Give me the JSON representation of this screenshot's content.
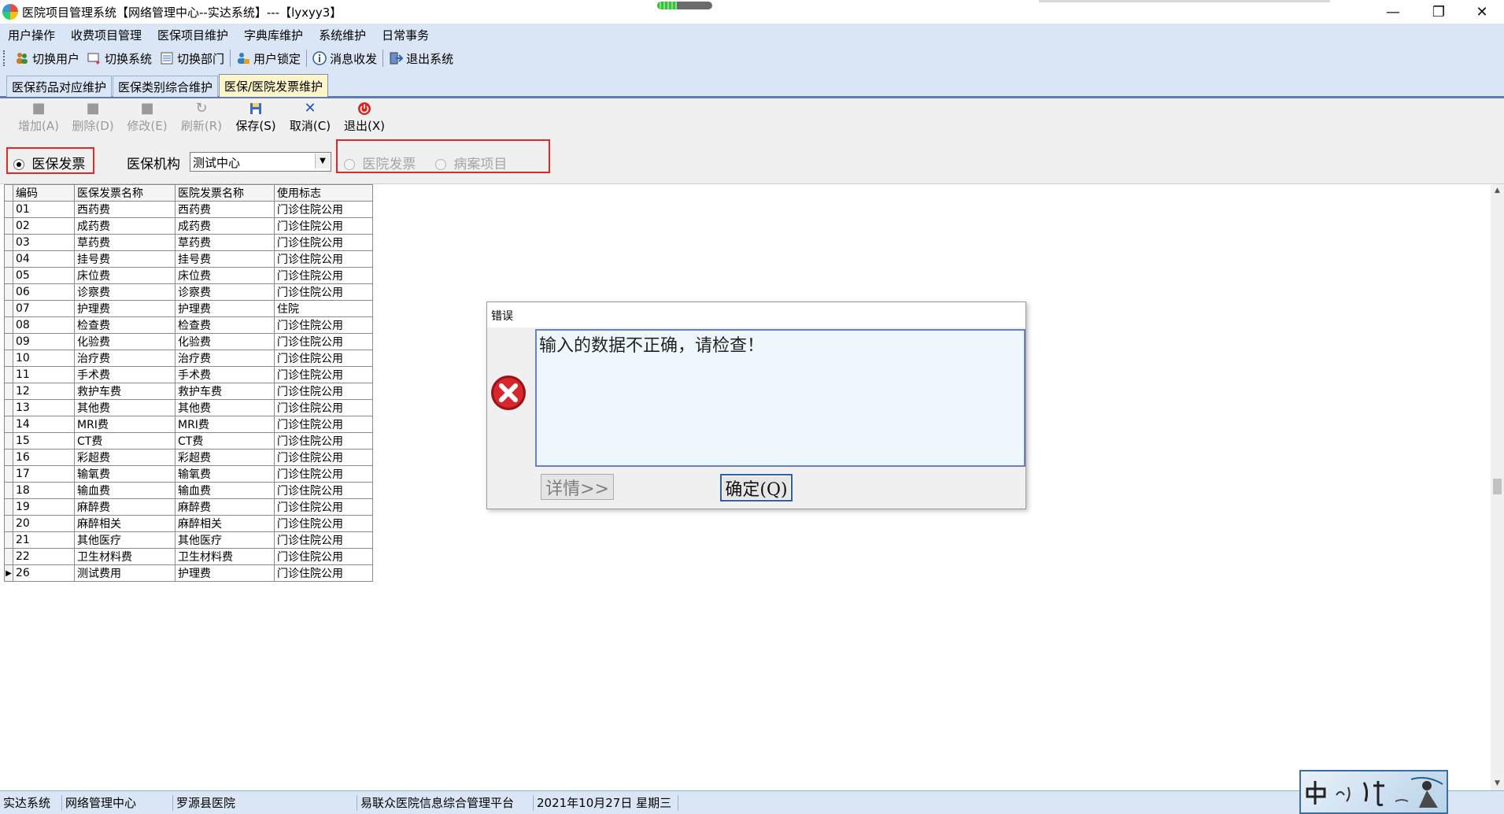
{
  "window": {
    "title": "医院项目管理系统【网络管理中心--实达系统】---【lyxyy3】",
    "controls": {
      "minimize": "—",
      "restore": "❐",
      "close": "✕"
    },
    "progress_fraction": 0.35
  },
  "menu": [
    "用户操作",
    "收费项目管理",
    "医保项目维护",
    "字典库维护",
    "系统维护",
    "日常事务"
  ],
  "quick_toolbar": [
    {
      "label": "切换用户",
      "icon": "users-icon"
    },
    {
      "label": "切换系统",
      "icon": "switch-system-icon"
    },
    {
      "label": "切换部门",
      "icon": "department-icon"
    },
    {
      "label": "用户锁定",
      "icon": "user-lock-icon"
    },
    {
      "label": "消息收发",
      "icon": "info-icon"
    },
    {
      "label": "退出系统",
      "icon": "exit-icon"
    }
  ],
  "tabs": [
    "医保药品对应维护",
    "医保类别综合维护",
    "医保/医院发票维护"
  ],
  "active_tab": "医保/医院发票维护",
  "action_toolbar": [
    {
      "label": "增加(A)",
      "enabled": false,
      "icon": "add-icon"
    },
    {
      "label": "删除(D)",
      "enabled": false,
      "icon": "delete-icon"
    },
    {
      "label": "修改(E)",
      "enabled": false,
      "icon": "edit-icon"
    },
    {
      "label": "刷新(R)",
      "enabled": false,
      "icon": "refresh-icon"
    },
    {
      "label": "保存(S)",
      "enabled": true,
      "icon": "save-icon"
    },
    {
      "label": "取消(C)",
      "enabled": true,
      "icon": "cancel-icon"
    },
    {
      "label": "退出(X)",
      "enabled": true,
      "icon": "power-icon"
    }
  ],
  "filter": {
    "insurance_invoice_label": "医保发票",
    "insurance_invoice_checked": true,
    "org_label": "医保机构",
    "org_value": "测试中心",
    "hospital_invoice_label": "医院发票",
    "case_item_label": "病案项目"
  },
  "grid": {
    "columns": [
      "编码",
      "医保发票名称",
      "医院发票名称",
      "使用标志"
    ],
    "rows": [
      [
        "01",
        "西药费",
        "西药费",
        "门诊住院公用"
      ],
      [
        "02",
        "成药费",
        "成药费",
        "门诊住院公用"
      ],
      [
        "03",
        "草药费",
        "草药费",
        "门诊住院公用"
      ],
      [
        "04",
        "挂号费",
        "挂号费",
        "门诊住院公用"
      ],
      [
        "05",
        "床位费",
        "床位费",
        "门诊住院公用"
      ],
      [
        "06",
        "诊察费",
        "诊察费",
        "门诊住院公用"
      ],
      [
        "07",
        "护理费",
        "护理费",
        "住院"
      ],
      [
        "08",
        "检查费",
        "检查费",
        "门诊住院公用"
      ],
      [
        "09",
        "化验费",
        "化验费",
        "门诊住院公用"
      ],
      [
        "10",
        "治疗费",
        "治疗费",
        "门诊住院公用"
      ],
      [
        "11",
        "手术费",
        "手术费",
        "门诊住院公用"
      ],
      [
        "12",
        "救护车费",
        "救护车费",
        "门诊住院公用"
      ],
      [
        "13",
        "其他费",
        "其他费",
        "门诊住院公用"
      ],
      [
        "14",
        "MRI费",
        "MRI费",
        "门诊住院公用"
      ],
      [
        "15",
        "CT费",
        "CT费",
        "门诊住院公用"
      ],
      [
        "16",
        "彩超费",
        "彩超费",
        "门诊住院公用"
      ],
      [
        "17",
        "输氧费",
        "输氧费",
        "门诊住院公用"
      ],
      [
        "18",
        "输血费",
        "输血费",
        "门诊住院公用"
      ],
      [
        "19",
        "麻醉费",
        "麻醉费",
        "门诊住院公用"
      ],
      [
        "20",
        "麻醉相关",
        "麻醉相关",
        "门诊住院公用"
      ],
      [
        "21",
        "其他医疗",
        "其他医疗",
        "门诊住院公用"
      ],
      [
        "22",
        "卫生材料费",
        "卫生材料费",
        "门诊住院公用"
      ],
      [
        "26",
        "测试费用",
        "护理费",
        "门诊住院公用"
      ]
    ],
    "current_row_indicator": "▶"
  },
  "dialog": {
    "title": "错误",
    "message": "输入的数据不正确，请检查！",
    "details_button": "详情>>",
    "ok_button": "确定(Q)"
  },
  "statusbar": [
    "实达系统",
    "网络管理中心",
    "罗源县医院",
    "易联众医院信息综合管理平台",
    "2021年10月27日 星期三"
  ],
  "colors": {
    "menu_bg": "#dae6f5",
    "active_tab_bg": "#fff5c8",
    "highlight_box": "#e02828",
    "error_icon": "#d9262c"
  }
}
